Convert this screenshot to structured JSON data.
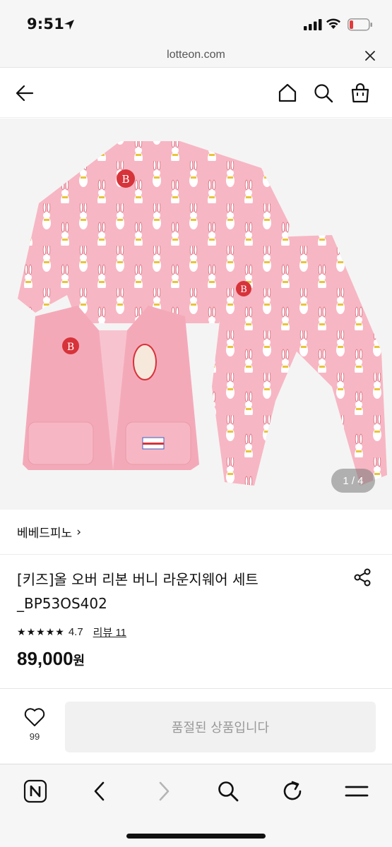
{
  "status_bar": {
    "time": "9:51"
  },
  "url_bar": {
    "domain": "lotteon.com"
  },
  "header": {
    "back_icon": "back-arrow-icon",
    "home_icon": "home-icon",
    "search_icon": "search-icon",
    "cart_icon": "shopping-bag-icon"
  },
  "product": {
    "image_counter": "1 / 4",
    "brand": "베베드피노",
    "brand_chevron": "›",
    "title": "[키즈]올 오버 리본 버니 라운지웨어 세트 _BP53OS402",
    "rating": "4.7",
    "rating_stars": 4.7,
    "review_link": "리뷰 11",
    "price": "89,000",
    "currency": "원"
  },
  "bottom": {
    "like_count": "99",
    "soldout_label": "품절된 상품입니다"
  },
  "colors": {
    "pink": "#f7b6c3",
    "accent_red": "#d7333a"
  }
}
